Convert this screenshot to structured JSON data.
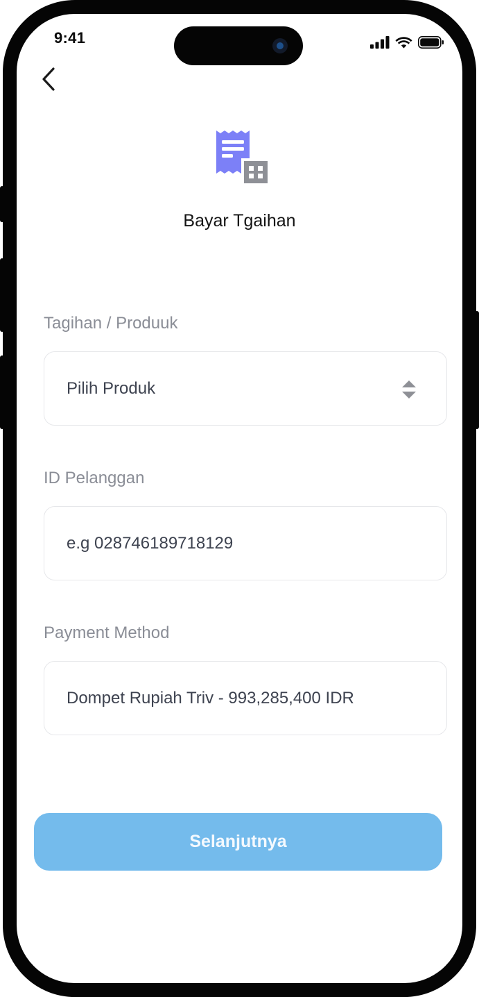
{
  "status_bar": {
    "time": "9:41"
  },
  "header": {
    "back_icon": "chevron-left-icon",
    "icon": "receipt-building-icon",
    "title": "Bayar Tgaihan"
  },
  "form": {
    "product": {
      "label": "Tagihan / Produuk",
      "selected_value": "Pilih Produk",
      "icon": "select-arrows-icon"
    },
    "customer_id": {
      "label": "ID Pelanggan",
      "placeholder": "e.g 028746189718129"
    },
    "payment_method": {
      "label": "Payment Method",
      "value": "Dompet Rupiah Triv - 993,285,400 IDR"
    }
  },
  "actions": {
    "next_label": "Selanjutnya"
  },
  "colors": {
    "accent_icon": "#7c80f7",
    "icon_secondary": "#8e9096",
    "button_bg": "#74bbec",
    "label_text": "#8a8d96"
  }
}
